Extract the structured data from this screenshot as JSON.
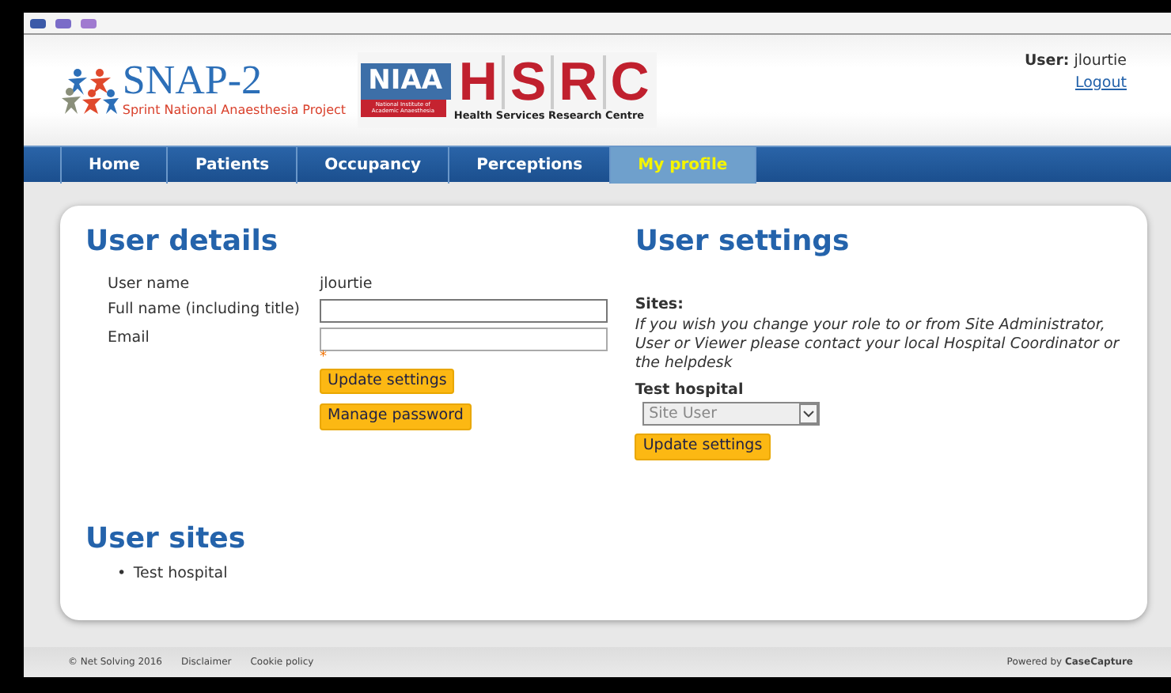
{
  "header": {
    "logo_title": "SNAP-2",
    "logo_subtitle": "Sprint National Anaesthesia Project",
    "niaa_title": "NIAA",
    "niaa_subtitle": "National Institute of Academic Anaesthesia",
    "hsrc_letters": [
      "H",
      "S",
      "R",
      "C"
    ],
    "hsrc_subtitle": "Health Services Research Centre",
    "user_label": "User:",
    "user_name": "jlourtie",
    "logout": "Logout"
  },
  "nav": [
    {
      "label": "Home",
      "selected": false
    },
    {
      "label": "Patients",
      "selected": false
    },
    {
      "label": "Occupancy",
      "selected": false
    },
    {
      "label": "Perceptions",
      "selected": false
    },
    {
      "label": "My profile",
      "selected": true
    }
  ],
  "user_details": {
    "title": "User details",
    "fields": [
      {
        "kind": "text",
        "label": "User name",
        "value": "jlourtie"
      },
      {
        "kind": "input",
        "label": "Full name (including title)",
        "required": false
      },
      {
        "kind": "input",
        "label": "Email",
        "required": true,
        "required_mark": "*"
      }
    ],
    "buttons": [
      "Update settings",
      "Manage password"
    ]
  },
  "user_settings": {
    "title": "User settings",
    "sites_label": "Sites:",
    "note": "If you wish you change your role to or from Site Administrator, User or Viewer please contact your local Hospital Coordinator or the helpdesk",
    "site_name": "Test hospital",
    "role": "Site User",
    "role_disabled": true,
    "button": "Update settings"
  },
  "user_sites": {
    "title": "User sites",
    "items": [
      {
        "bullet": "•",
        "label": "Test hospital"
      }
    ]
  },
  "footer": {
    "links": [
      "© Net Solving 2016",
      "Disclaimer",
      "Cookie policy"
    ],
    "powered": "Powered by **CaseCapture**"
  }
}
